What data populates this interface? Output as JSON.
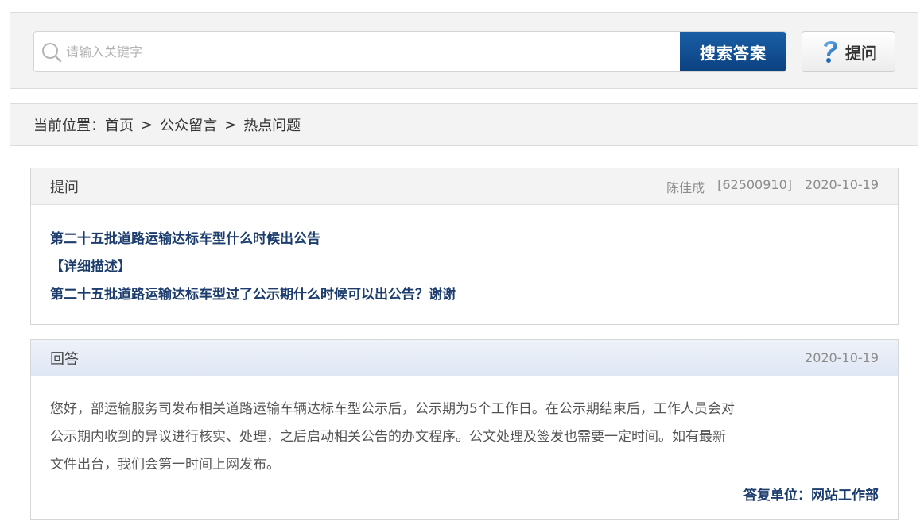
{
  "search": {
    "placeholder": "请输入关键字",
    "button_label": "搜索答案",
    "ask_label": "提问"
  },
  "breadcrumb": {
    "prefix": "当前位置：",
    "items": [
      "首页",
      "公众留言",
      "热点问题"
    ],
    "separator": ">"
  },
  "question": {
    "header": "提问",
    "author": "陈佳成",
    "id": "[62500910]",
    "date": "2020-10-19",
    "title": "第二十五批道路运输达标车型什么时候出公告",
    "detail_label": "【详细描述】",
    "detail_text": "第二十五批道路运输达标车型过了公示期什么时候可以出公告？谢谢"
  },
  "answer": {
    "header": "回答",
    "date": "2020-10-19",
    "lines": [
      "您好，部运输服务司发布相关道路运输车辆达标车型公示后，公示期为5个工作日。在公示期结束后，工作人员会对",
      "公示期内收到的异议进行核实、处理，之后启动相关公告的办文程序。公文处理及签发也需要一定时间。如有最新",
      "文件出台，我们会第一时间上网发布。"
    ],
    "signature": "答复单位：网站工作部"
  },
  "colors": {
    "search_button": "#0b4080",
    "question_text": "#1c3d6e"
  }
}
